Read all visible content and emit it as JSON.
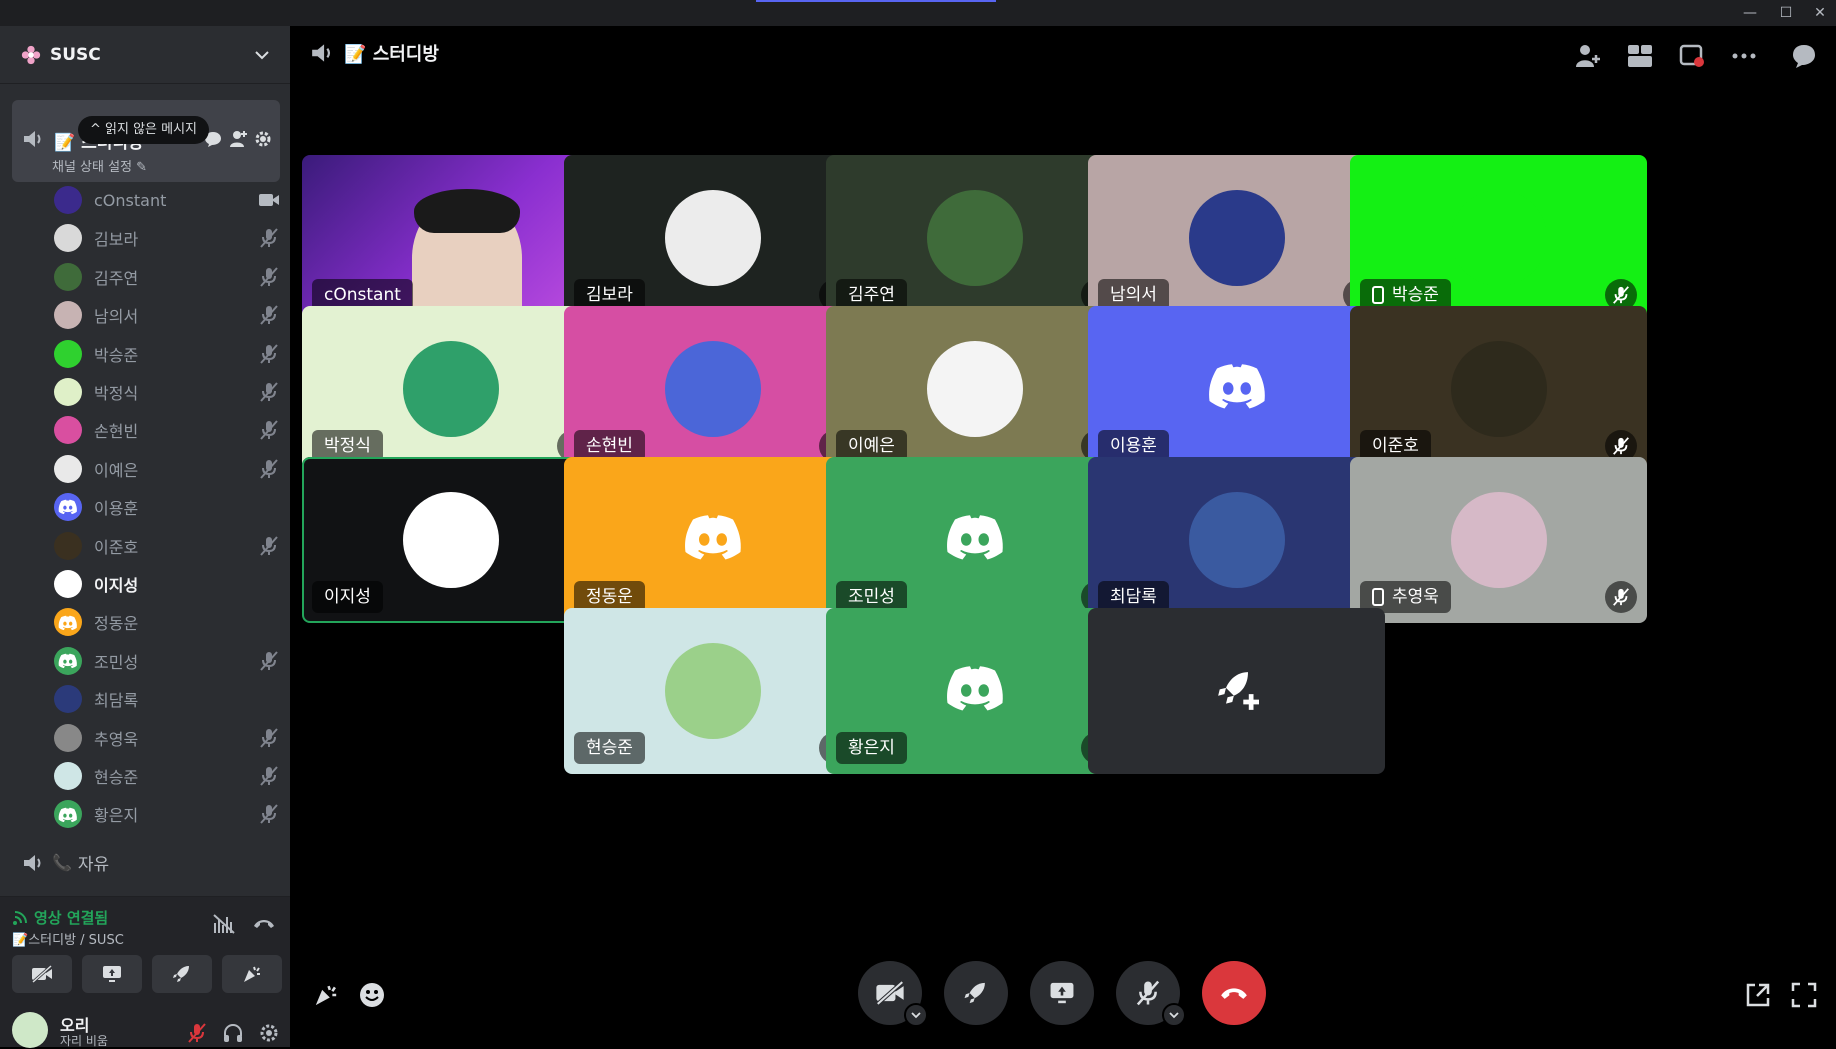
{
  "server": {
    "name": "SUSC"
  },
  "active_channel": {
    "name": "스터디방",
    "status": "채널 상태 설정",
    "tooltip": "읽지 않은 메시지"
  },
  "members": [
    {
      "name": "cOnstant",
      "state": "video",
      "bold": false,
      "color": "#3b2a8c"
    },
    {
      "name": "김보라",
      "state": "muted",
      "bold": false,
      "color": "#d9d9d9"
    },
    {
      "name": "김주연",
      "state": "muted",
      "bold": false,
      "color": "#3f6b3a"
    },
    {
      "name": "남의서",
      "state": "muted",
      "bold": false,
      "color": "#c7b3b3"
    },
    {
      "name": "박승준",
      "state": "muted",
      "bold": false,
      "color": "#2fd12f"
    },
    {
      "name": "박정식",
      "state": "muted",
      "bold": false,
      "color": "#dff0c8"
    },
    {
      "name": "손현빈",
      "state": "muted",
      "bold": false,
      "color": "#d94fa0"
    },
    {
      "name": "이예은",
      "state": "muted",
      "bold": false,
      "color": "#e9e9e9"
    },
    {
      "name": "이용훈",
      "state": "none",
      "bold": false,
      "color": "#5865f2"
    },
    {
      "name": "이준호",
      "state": "muted",
      "bold": false,
      "color": "#3a3020"
    },
    {
      "name": "이지성",
      "state": "none",
      "bold": true,
      "color": "#ffffff"
    },
    {
      "name": "정동운",
      "state": "none",
      "bold": false,
      "color": "#faa61a"
    },
    {
      "name": "조민성",
      "state": "muted",
      "bold": false,
      "color": "#3ba55c"
    },
    {
      "name": "최담록",
      "state": "none",
      "bold": false,
      "color": "#2b3a7a"
    },
    {
      "name": "추영욱",
      "state": "muted",
      "bold": false,
      "color": "#888888"
    },
    {
      "name": "현승준",
      "state": "muted",
      "bold": false,
      "color": "#cfe6e6"
    },
    {
      "name": "황은지",
      "state": "muted",
      "bold": false,
      "color": "#3ba55c"
    }
  ],
  "free_channel": {
    "name": "자유"
  },
  "voice_panel": {
    "status": "영상 연결됨",
    "sub": "스터디방 / SUSC"
  },
  "user": {
    "name": "오리",
    "status": "자리 비움"
  },
  "main_title": "스터디방",
  "tiles": [
    {
      "name": "cOnstant",
      "bg": "#6a2fb5",
      "kind": "video",
      "mute": false,
      "phone": false
    },
    {
      "name": "김보라",
      "bg": "#1e2320",
      "kind": "avatar",
      "av": "#ececec",
      "mute": true,
      "phone": false
    },
    {
      "name": "김주연",
      "bg": "#2e3b2c",
      "kind": "avatar",
      "av": "#3f6b3a",
      "mute": true,
      "phone": false
    },
    {
      "name": "남의서",
      "bg": "#b8a5a5",
      "kind": "avatar",
      "av": "#2a3a8a",
      "mute": true,
      "phone": false
    },
    {
      "name": "박승준",
      "bg": "#14f014",
      "kind": "avatar",
      "av": "#14f014",
      "mute": true,
      "phone": true
    },
    {
      "name": "박정식",
      "bg": "#e3f2d2",
      "kind": "avatar",
      "av": "#2fa06a",
      "mute": true,
      "phone": false
    },
    {
      "name": "손현빈",
      "bg": "#d64ea3",
      "kind": "avatar",
      "av": "#4b66d8",
      "mute": true,
      "phone": false
    },
    {
      "name": "이예은",
      "bg": "#7d7a52",
      "kind": "avatar",
      "av": "#f4f4f4",
      "mute": true,
      "phone": false
    },
    {
      "name": "이용훈",
      "bg": "#5865f2",
      "kind": "discord",
      "mute": false,
      "phone": false
    },
    {
      "name": "이준호",
      "bg": "#3a3222",
      "kind": "avatar",
      "av": "#2e2a1c",
      "mute": true,
      "phone": false
    },
    {
      "name": "이지성",
      "bg": "#111214",
      "kind": "avatar",
      "av": "#ffffff",
      "mute": false,
      "phone": false,
      "speaking": true
    },
    {
      "name": "정동운",
      "bg": "#faa61a",
      "kind": "discord",
      "mute": false,
      "phone": false
    },
    {
      "name": "조민성",
      "bg": "#3ba55c",
      "kind": "discord",
      "mute": true,
      "phone": false
    },
    {
      "name": "최담록",
      "bg": "#2a3672",
      "kind": "avatar",
      "av": "#3a5aa0",
      "mute": false,
      "phone": false
    },
    {
      "name": "추영욱",
      "bg": "#a3a7a3",
      "kind": "avatar",
      "av": "#d6b9c7",
      "mute": true,
      "phone": true
    },
    {
      "name": "현승준",
      "bg": "#cfe6e6",
      "kind": "avatar",
      "av": "#9bd08a",
      "mute": true,
      "phone": false
    },
    {
      "name": "황은지",
      "bg": "#3ba55c",
      "kind": "discord",
      "mute": true,
      "phone": false
    },
    {
      "name": "",
      "bg": "#2b2d31",
      "kind": "activity",
      "mute": false,
      "phone": false
    }
  ],
  "colors": {
    "accent": "#5865f2",
    "green": "#23a55a",
    "red": "#da373c"
  }
}
